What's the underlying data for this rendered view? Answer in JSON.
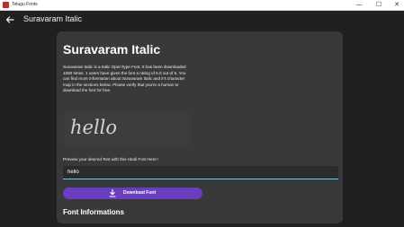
{
  "window": {
    "title": "Telugu Fonts",
    "minimize_glyph": "—",
    "maximize_glyph": "☐",
    "close_glyph": "✕",
    "app_icon": "app-icon"
  },
  "header": {
    "title": "Suravaram Italic",
    "back_icon": "back-arrow-icon"
  },
  "font": {
    "name": "Suravaram Italic",
    "description": " Suravaram Italic  is a Italic OpenType Font. It has been downloaded 1090 times. 1 users have given the font a rating of 5.0 out of 5. You can find more information about Suravaram Italic and it's character map in the sections below. Please verify that you're a human to download the font for free.",
    "sample_text": "hello"
  },
  "preview": {
    "label": "Preview your desired Text with this Hindi Font Here !",
    "value": "hello"
  },
  "download": {
    "label": "Download Font",
    "icon": "download-icon"
  },
  "sections": {
    "info_heading": "Font Informations"
  },
  "colors": {
    "background": "#202020",
    "card": "#393939",
    "accent": "#6a3fbf",
    "input_focus": "#60cdff"
  }
}
